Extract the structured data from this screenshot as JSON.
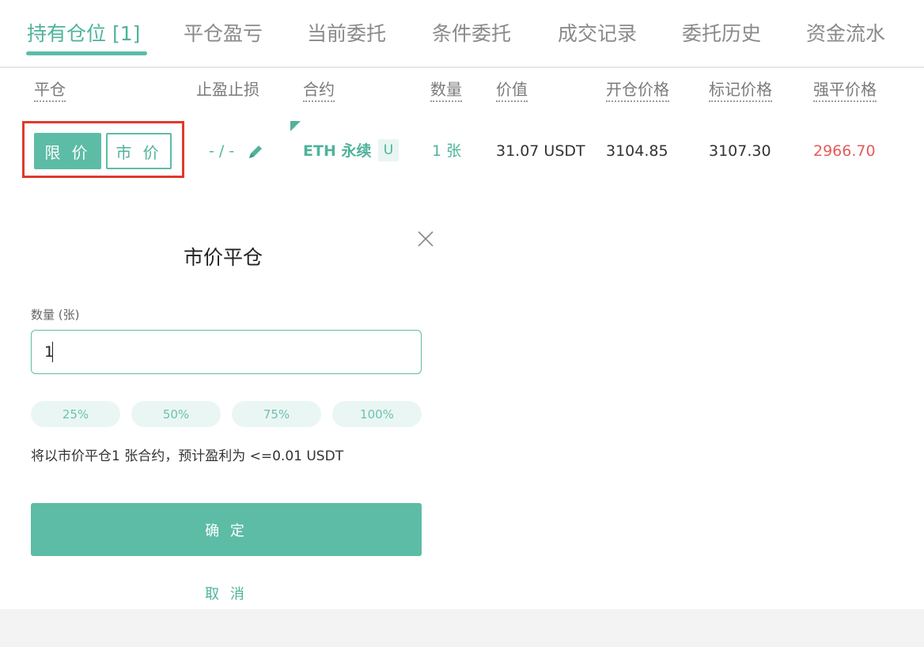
{
  "tabs": [
    {
      "label": "持有仓位 [1]",
      "active": true
    },
    {
      "label": "平仓盈亏"
    },
    {
      "label": "当前委托"
    },
    {
      "label": "条件委托"
    },
    {
      "label": "成交记录"
    },
    {
      "label": "委托历史"
    },
    {
      "label": "资金流水"
    }
  ],
  "table": {
    "headers": {
      "close": "平仓",
      "tpsl": "止盈止损",
      "contract": "合约",
      "qty": "数量",
      "value": "价值",
      "open_price": "开仓价格",
      "mark_price": "标记价格",
      "liq_price": "强平价格"
    },
    "row": {
      "limit_btn": "限 价",
      "market_btn": "市 价",
      "tpsl": "- / -",
      "contract": "ETH 永续",
      "contract_badge": "U",
      "qty": "1 张",
      "value": "31.07 USDT",
      "open_price": "3104.85",
      "mark_price": "3107.30",
      "liq_price": "2966.70"
    }
  },
  "dialog": {
    "title": "市价平仓",
    "qty_label": "数量 (张)",
    "qty_value": "1",
    "percents": [
      "25%",
      "50%",
      "75%",
      "100%"
    ],
    "hint": "将以市价平仓1 张合约，预计盈利为 <=0.01 USDT",
    "confirm": "确 定",
    "cancel": "取 消"
  },
  "colors": {
    "accent": "#5dbca6",
    "loss": "#e55b5b",
    "highlight": "#e0392b"
  }
}
